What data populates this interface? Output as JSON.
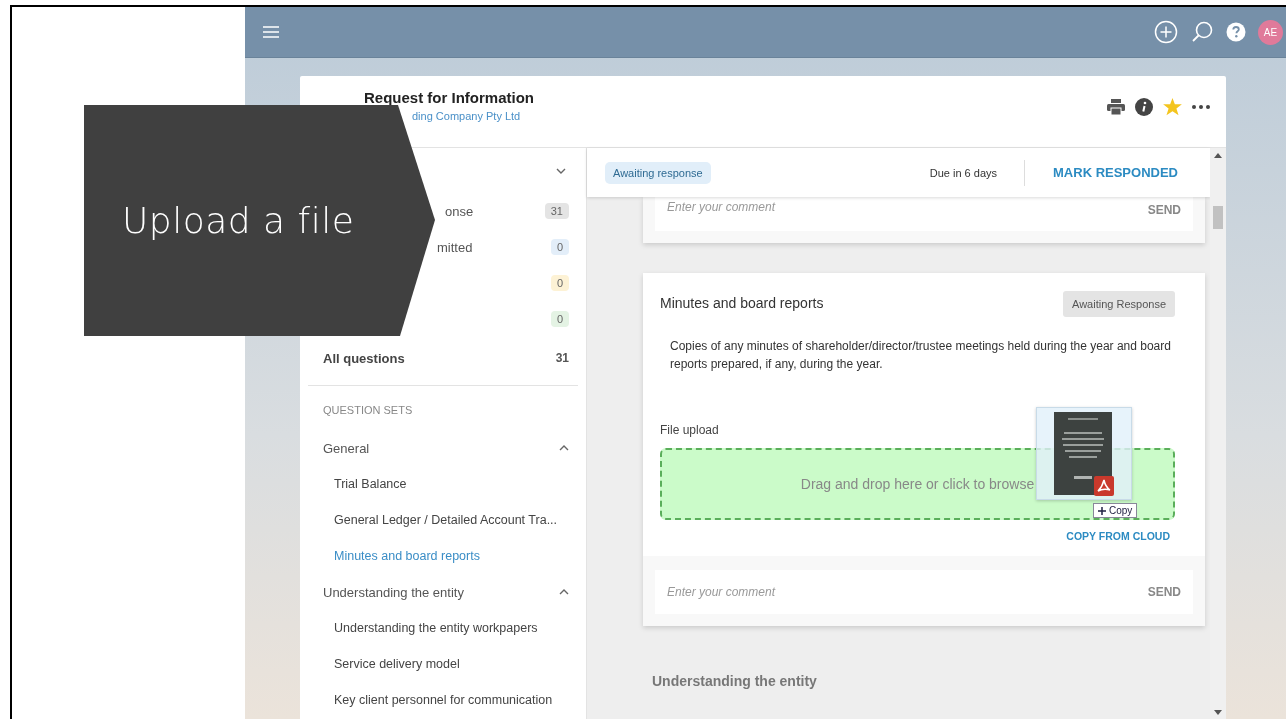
{
  "callout": {
    "text": "Upload a file"
  },
  "top_bar": {
    "avatar": "AE"
  },
  "header": {
    "title": "Request for Information",
    "subtitle": "ding Company Pty Ltd"
  },
  "sidebar": {
    "status_items": [
      {
        "label": "onse",
        "count": "31",
        "color": "#e4e4e4"
      },
      {
        "label": "mitted",
        "count": "0",
        "color": "#e3eef9"
      },
      {
        "count": "0",
        "color": "#fdf2d5"
      },
      {
        "count": "0",
        "color": "#e4f3e4"
      }
    ],
    "all": {
      "label": "All questions",
      "count": "31"
    },
    "sets_heading": "QUESTION SETS",
    "sets": [
      {
        "label": "General",
        "expanded": true,
        "children": [
          {
            "label": "Trial Balance",
            "selected": false
          },
          {
            "label": "General Ledger / Detailed Account Tra...",
            "selected": false
          },
          {
            "label": "Minutes and board reports",
            "selected": true
          }
        ]
      },
      {
        "label": "Understanding the entity",
        "expanded": true,
        "children": [
          {
            "label": "Understanding the entity workpapers",
            "selected": false
          },
          {
            "label": "Service delivery model",
            "selected": false
          },
          {
            "label": "Key client personnel for communication",
            "selected": false
          }
        ]
      }
    ]
  },
  "status_bar": {
    "status": "Awaiting response",
    "due": "Due in 6 days",
    "action": "MARK RESPONDED"
  },
  "prev_card": {
    "comment_placeholder": "Enter your comment",
    "send": "SEND"
  },
  "question": {
    "title": "Minutes and board reports",
    "status": "Awaiting Response",
    "description": "Copies of any minutes of shareholder/director/trustee meetings held during the year and board reports prepared, if any, during the year.",
    "upload_label": "File upload",
    "drop_text": "Drag and drop here or click to browse",
    "drag_hint": "Copy",
    "cloud_link": "COPY FROM CLOUD",
    "comment_placeholder": "Enter your comment",
    "send": "SEND"
  },
  "next_section": "Understanding the entity"
}
